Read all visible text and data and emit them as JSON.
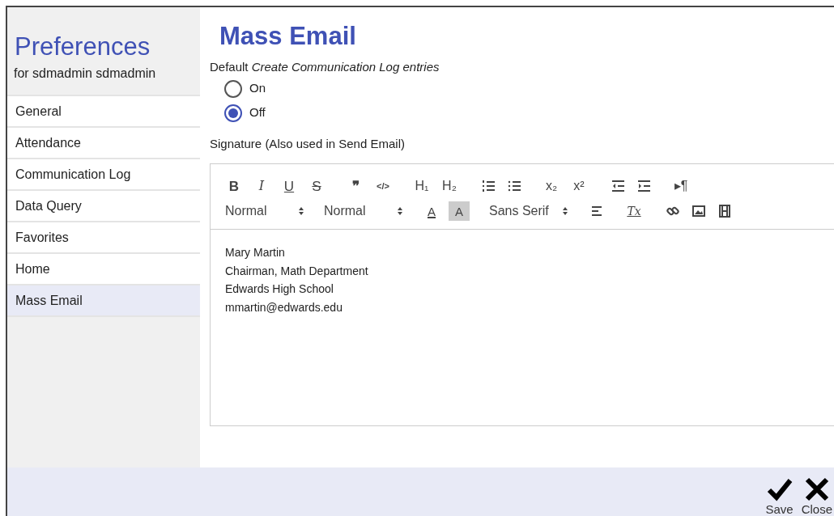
{
  "sidebar": {
    "title": "Preferences",
    "subtitle": "for sdmadmin sdmadmin",
    "items": [
      {
        "label": "General",
        "selected": false
      },
      {
        "label": "Attendance",
        "selected": false
      },
      {
        "label": "Communication Log",
        "selected": false
      },
      {
        "label": "Data Query",
        "selected": false
      },
      {
        "label": "Favorites",
        "selected": false
      },
      {
        "label": "Home",
        "selected": false
      },
      {
        "label": "Mass Email",
        "selected": true
      }
    ]
  },
  "main": {
    "title": "Mass Email",
    "log_setting": {
      "label": "Default *Create Communication Log entries*",
      "options": [
        {
          "label": "On",
          "selected": false
        },
        {
          "label": "Off",
          "selected": true
        }
      ]
    },
    "signature": {
      "label": "Signature (Also used in Send Email)",
      "toolbar": [
        [
          [
            {
              "kind": "bold",
              "text": "B"
            },
            {
              "kind": "italic",
              "text": "I"
            },
            {
              "kind": "underline",
              "text": "U"
            },
            {
              "kind": "strike",
              "text": "S"
            }
          ],
          [
            {
              "kind": "quote",
              "text": "❞"
            },
            {
              "kind": "code",
              "text": "</>"
            }
          ],
          [
            {
              "kind": "plain",
              "text": "H₁"
            },
            {
              "kind": "plain",
              "text": "H₂"
            }
          ],
          [
            {
              "kind": "orderedlist"
            },
            {
              "kind": "bulletlist"
            }
          ],
          [
            {
              "kind": "plain",
              "text": "x₂"
            },
            {
              "kind": "plain",
              "text": "x²"
            }
          ],
          [
            {
              "kind": "outdent"
            },
            {
              "kind": "indent"
            }
          ],
          [
            {
              "kind": "plain",
              "text": "▸¶"
            }
          ]
        ],
        [
          [
            {
              "kind": "select",
              "text": "Normal"
            }
          ],
          [
            {
              "kind": "select",
              "text": "Normal"
            }
          ],
          [
            {
              "kind": "color",
              "text": "A"
            },
            {
              "kind": "highlight",
              "text": "A"
            }
          ],
          [
            {
              "kind": "select",
              "text": "Sans Serif"
            }
          ],
          [
            {
              "kind": "align"
            }
          ],
          [
            {
              "kind": "clean",
              "text": "Tx"
            }
          ],
          [
            {
              "kind": "link"
            },
            {
              "kind": "image"
            },
            {
              "kind": "video"
            }
          ]
        ]
      ],
      "lines": [
        "Mary Martin",
        "Chairman, Math Department",
        "Edwards High School",
        "mmartin@edwards.edu"
      ]
    }
  },
  "footer": {
    "buttons": [
      {
        "label": "Save",
        "kind": "save"
      },
      {
        "label": "Close",
        "kind": "close"
      }
    ]
  }
}
